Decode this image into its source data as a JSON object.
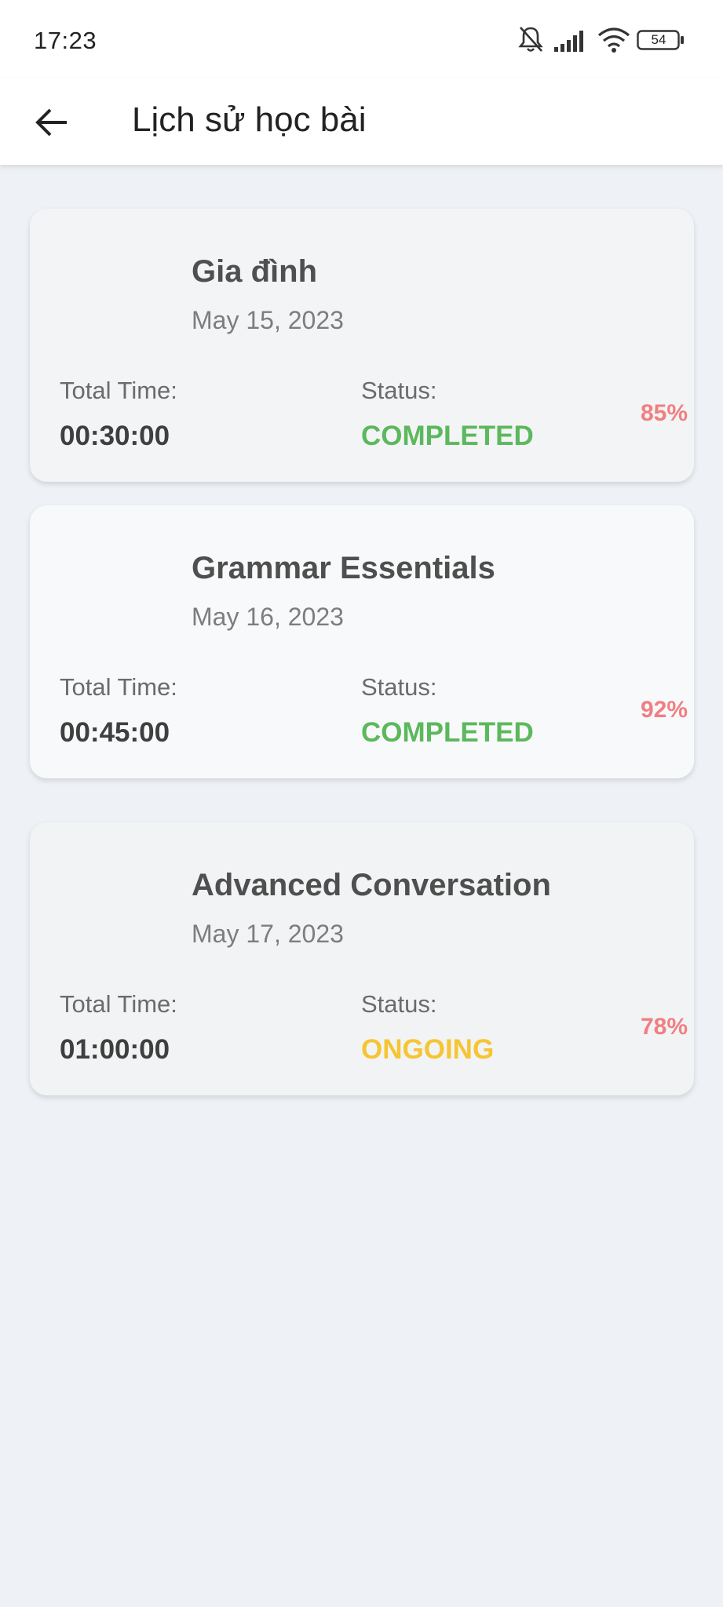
{
  "status_bar": {
    "time": "17:23",
    "battery": "54",
    "icons": [
      "bell-off-icon",
      "signal-icon",
      "wifi-icon",
      "battery-icon"
    ]
  },
  "app_bar": {
    "back_icon": "arrow-left-icon",
    "title": "Lịch sử học bài"
  },
  "colors": {
    "completed": "#5cb85c",
    "ongoing": "#f5c533",
    "score": "#f07f82",
    "background": "#eef1f6"
  },
  "lessons": [
    {
      "title": "Gia đình",
      "date": "May 15, 2023",
      "total_time_label": "Total Time:",
      "total_time": "00:30:00",
      "status_label": "Status:",
      "status": "COMPLETED",
      "score": "85%"
    },
    {
      "title": "Grammar Essentials",
      "date": "May 16, 2023",
      "total_time_label": "Total Time:",
      "total_time": "00:45:00",
      "status_label": "Status:",
      "status": "COMPLETED",
      "score": "92%"
    },
    {
      "title": "Advanced Conversation",
      "date": "May 17, 2023",
      "total_time_label": "Total Time:",
      "total_time": "01:00:00",
      "status_label": "Status:",
      "status": "ONGOING",
      "score": "78%"
    }
  ]
}
